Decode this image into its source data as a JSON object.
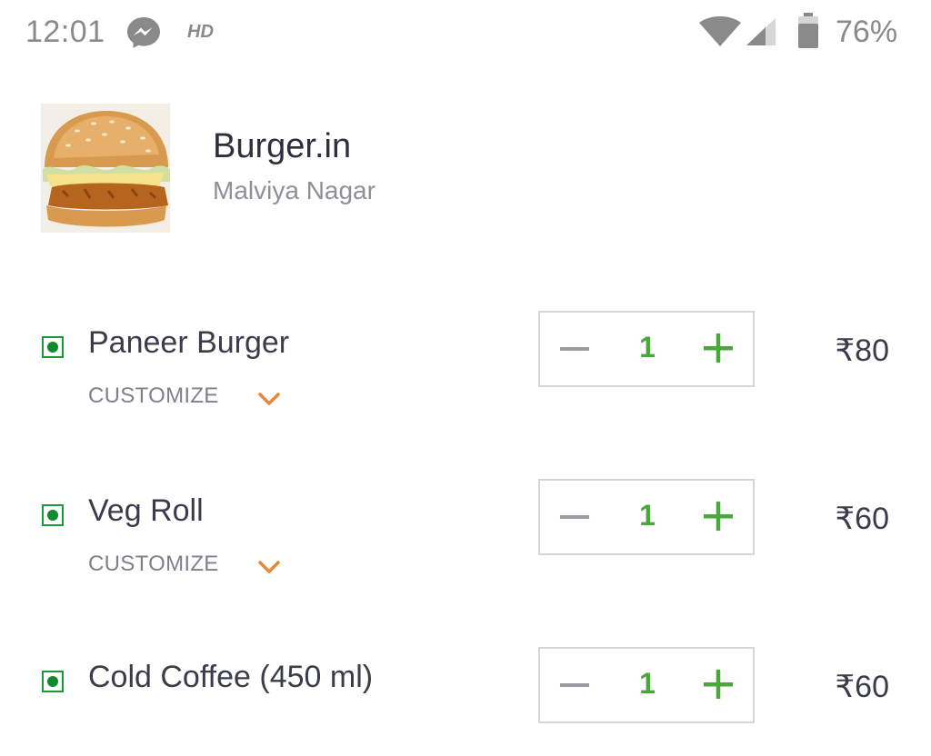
{
  "status_bar": {
    "time": "12:01",
    "hd_label": "HD",
    "battery_percent": "76%",
    "icons": [
      "messenger-icon",
      "wifi-icon",
      "signal-icon",
      "battery-icon"
    ]
  },
  "restaurant": {
    "name": "Burger.in",
    "area": "Malviya Nagar",
    "photo": "burger-photo"
  },
  "items": [
    {
      "name": "Paneer Burger",
      "customize_label": "CUSTOMIZE",
      "quantity": "1",
      "price": "₹80",
      "veg": true
    },
    {
      "name": "Veg Roll",
      "customize_label": "CUSTOMIZE",
      "quantity": "1",
      "price": "₹60",
      "veg": true
    },
    {
      "name": "Cold Coffee (450 ml)",
      "quantity": "1",
      "price": "₹60",
      "veg": true
    }
  ],
  "colors": {
    "accent_green": "#48a83a",
    "veg_green": "#0f8a2d",
    "customize_chevron": "#e8893a",
    "text_dark": "#3a3c4c",
    "text_muted": "#7e808c"
  }
}
